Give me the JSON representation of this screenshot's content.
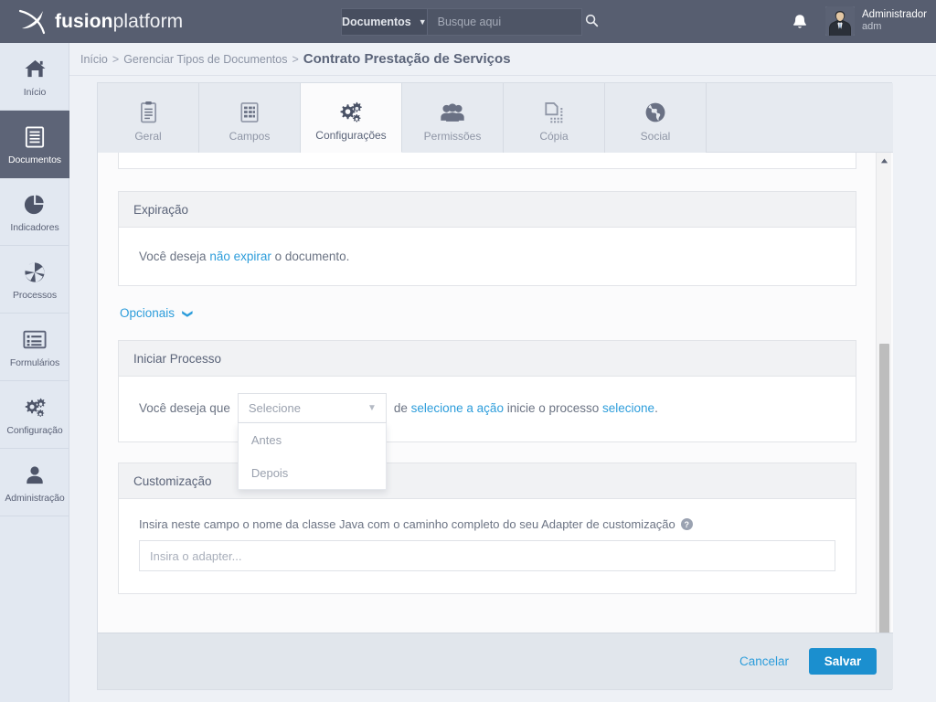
{
  "app": {
    "brand_bold": "fusion",
    "brand_light": "platform",
    "logo_icon": "fusion-x-logo-icon",
    "topbar_color": "#575e70",
    "accent_color": "#2d9ddb",
    "save_button_color": "#1b8fcf"
  },
  "search": {
    "scope_label": "Documentos",
    "scope_caret_icon": "chevron-down-icon",
    "placeholder": "Busque aqui",
    "value": "",
    "search_icon": "search-icon"
  },
  "topbar": {
    "bell_icon": "bell-icon",
    "avatar_icon": "user-avatar-icon",
    "user_name": "Administrador",
    "user_login": "adm"
  },
  "sidebar": {
    "items": [
      {
        "label": "Início",
        "icon": "home-icon",
        "active": false
      },
      {
        "label": "Documentos",
        "icon": "document-icon",
        "active": true
      },
      {
        "label": "Indicadores",
        "icon": "pie-chart-icon",
        "active": false
      },
      {
        "label": "Processos",
        "icon": "aperture-icon",
        "active": false
      },
      {
        "label": "Formulários",
        "icon": "form-list-icon",
        "active": false
      },
      {
        "label": "Configuração",
        "icon": "gears-icon",
        "active": false
      },
      {
        "label": "Administração",
        "icon": "person-icon",
        "active": false
      }
    ]
  },
  "breadcrumb": {
    "items": [
      "Início",
      "Gerenciar Tipos de Documentos"
    ],
    "separator": ">",
    "current": "Contrato Prestação de Serviços"
  },
  "tabs": [
    {
      "label": "Geral",
      "icon": "clipboard-icon",
      "active": false
    },
    {
      "label": "Campos",
      "icon": "fields-grid-icon",
      "active": false
    },
    {
      "label": "Configurações",
      "icon": "gears-icon",
      "active": true
    },
    {
      "label": "Permissões",
      "icon": "people-icon",
      "active": false
    },
    {
      "label": "Cópia",
      "icon": "copy-icon",
      "active": false
    },
    {
      "label": "Social",
      "icon": "globe-icon",
      "active": false
    }
  ],
  "main": {
    "expiracao": {
      "title": "Expiração",
      "sentence_before": "Você deseja ",
      "link": "não expirar",
      "sentence_after": " o documento."
    },
    "opcionais": {
      "label": "Opcionais",
      "chevron_icon": "chevron-down-icon"
    },
    "iniciar_processo": {
      "title": "Iniciar Processo",
      "sentence_prefix": "Você deseja que",
      "select": {
        "selected_label": "Selecione",
        "caret_icon": "chevron-down-icon",
        "expanded": true,
        "options": [
          "Antes",
          "Depois"
        ]
      },
      "suffix_de": "de ",
      "suffix_link_action": "selecione a ação",
      "suffix_middle": " inicie o processo ",
      "suffix_link_process": "selecione",
      "suffix_end": "."
    },
    "customizacao": {
      "title": "Customização",
      "field_label": "Insira neste campo o nome da classe Java com o caminho completo do seu Adapter de customização",
      "help_icon": "help-circle-icon",
      "help_glyph": "?",
      "input_placeholder": "Insira o adapter...",
      "input_value": ""
    }
  },
  "footer": {
    "cancel_label": "Cancelar",
    "save_label": "Salvar"
  },
  "scrollbar": {
    "up_icon": "triangle-up-icon",
    "down_icon": "triangle-down-icon"
  }
}
